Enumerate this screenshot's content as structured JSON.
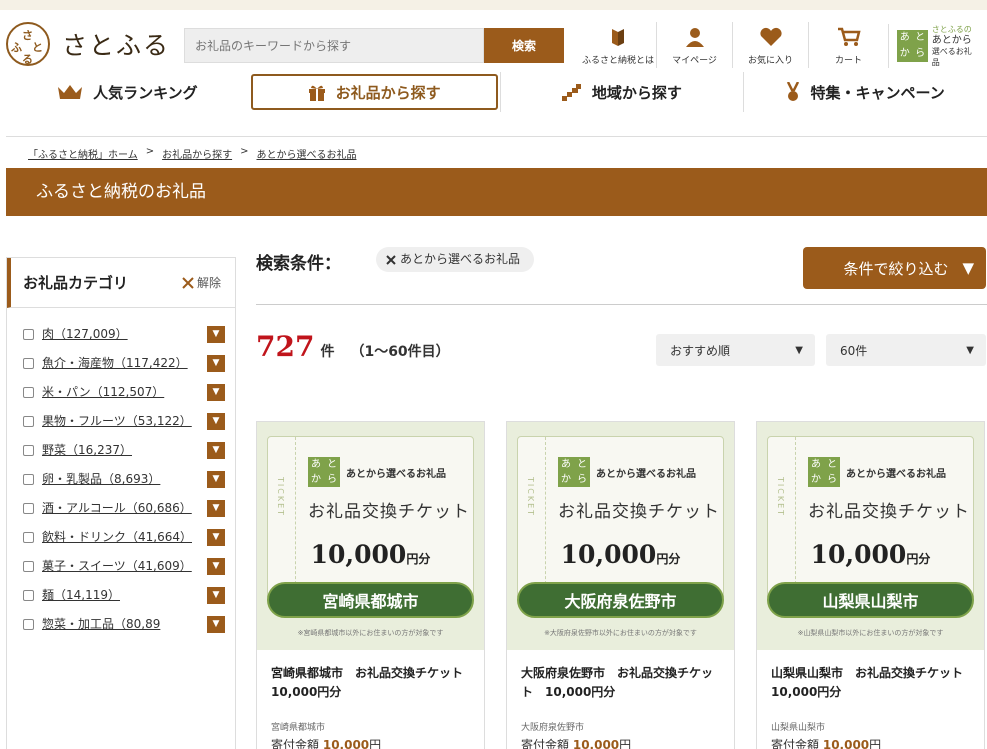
{
  "header": {
    "logo_text": "さとふる",
    "logo_mark": "さとふる",
    "search_placeholder": "お礼品のキーワードから探す",
    "search_button": "検索",
    "links": [
      {
        "label": "ふるさと納税とは",
        "icon": "book-icon"
      },
      {
        "label": "マイページ",
        "icon": "user-icon"
      },
      {
        "label": "お気に入り",
        "icon": "heart-icon"
      },
      {
        "label": "カート",
        "icon": "cart-icon"
      }
    ],
    "atokara": {
      "c1": "あ",
      "c2": "と",
      "c3": "か",
      "c4": "ら",
      "line1": "さとふるの",
      "line2": "あとから",
      "line3": "選べるお礼品"
    }
  },
  "nav": [
    {
      "label": "人気ランキング",
      "icon": "crown-icon"
    },
    {
      "label": "お礼品から探す",
      "icon": "gift-icon",
      "active": true
    },
    {
      "label": "地域から探す",
      "icon": "map-icon"
    },
    {
      "label": "特集・キャンペーン",
      "icon": "medal-icon"
    }
  ],
  "breadcrumb": [
    "「ふるさと納税」ホーム",
    "お礼品から探す",
    "あとから選べるお礼品"
  ],
  "breadcrumb_sep": ">",
  "page_title": "ふるさと納税のお礼品",
  "sidebar": {
    "title": "お礼品カテゴリ",
    "clear": "解除",
    "categories": [
      "肉（127,009）",
      "魚介・海産物（117,422）",
      "米・パン（112,507）",
      "果物・フルーツ（53,122）",
      "野菜（16,237）",
      "卵・乳製品（8,693）",
      "酒・アルコール（60,686）",
      "飲料・ドリンク（41,664）",
      "菓子・スイーツ（41,609）",
      "麺（14,119）",
      "惣菜・加工品（80,89"
    ]
  },
  "conditions": {
    "label": "検索条件：",
    "chip": "あとから選べるお礼品",
    "filter_button": "条件で絞り込む"
  },
  "results": {
    "count": "727",
    "unit": "件",
    "range": "（1〜60件目）",
    "sort": "おすすめ順",
    "per_page": "60件"
  },
  "ticket": {
    "side": "TICKET",
    "badge_c1": "あ",
    "badge_c2": "と",
    "badge_c3": "か",
    "badge_c4": "ら",
    "badge_text": "あとから選べるお礼品",
    "title": "お礼品交換チケット",
    "amount": "10,000",
    "amount_unit": "円分"
  },
  "products": [
    {
      "city": "宮崎県都城市",
      "note": "※宮崎県都城市以外にお住まいの方が対象です",
      "title": "宮崎県都城市　お礼品交換チケット　10,000円分",
      "muni": "宮崎県都城市",
      "price_label": "寄付金額",
      "price": "10,000",
      "price_unit": "円"
    },
    {
      "city": "大阪府泉佐野市",
      "note": "※大阪府泉佐野市以外にお住まいの方が対象です",
      "title": "大阪府泉佐野市　お礼品交換チケット　10,000円分",
      "muni": "大阪府泉佐野市",
      "price_label": "寄付金額",
      "price": "10,000",
      "price_unit": "円"
    },
    {
      "city": "山梨県山梨市",
      "note": "※山梨県山梨市以外にお住まいの方が対象です",
      "title": "山梨県山梨市　お礼品交換チケット　10,000円分",
      "muni": "山梨県山梨市",
      "price_label": "寄付金額",
      "price": "10,000",
      "price_unit": "円"
    }
  ],
  "colors": {
    "brand": "#9b5b1b",
    "price": "#c0141b",
    "ticket_green": "#3f6e33"
  }
}
